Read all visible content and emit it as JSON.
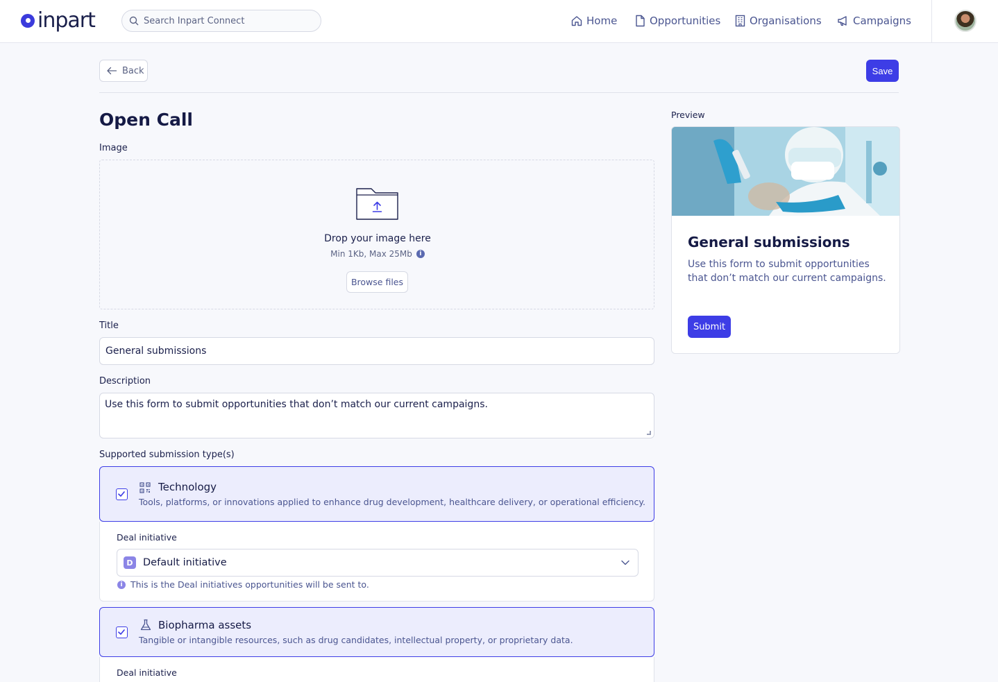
{
  "header": {
    "logo_text": "inpart",
    "search": {
      "placeholder": "Search Inpart Connect"
    },
    "nav": [
      {
        "label": "Home",
        "icon": "home-icon"
      },
      {
        "label": "Opportunities",
        "icon": "file-icon"
      },
      {
        "label": "Organisations",
        "icon": "building-icon"
      },
      {
        "label": "Campaigns",
        "icon": "megaphone-icon"
      }
    ]
  },
  "toolbar": {
    "back_label": "Back",
    "save_label": "Save"
  },
  "form": {
    "page_title": "Open Call",
    "image_label": "Image",
    "dropzone": {
      "title": "Drop your image here",
      "hint": "Min 1Kb, Max 25Mb",
      "browse_label": "Browse files"
    },
    "title_label": "Title",
    "title_value": "General submissions",
    "description_label": "Description",
    "description_value": "Use this form to submit opportunities that don’t match our current campaigns.",
    "types_label": "Supported submission type(s)",
    "types": [
      {
        "name": "Technology",
        "icon": "qr-grid-icon",
        "checked": true,
        "description": "Tools, platforms, or innovations applied to enhance drug development, healthcare delivery, or operational efficiency.",
        "deal_label": "Deal initiative",
        "deal_badge": "D",
        "deal_value": "Default initiative",
        "deal_hint": "This is the Deal initiatives opportunities will be sent to."
      },
      {
        "name": "Biopharma assets",
        "icon": "flask-icon",
        "checked": true,
        "description": "Tangible or intangible resources, such as drug candidates, intellectual property, or proprietary data.",
        "deal_label": "Deal initiative"
      }
    ]
  },
  "preview": {
    "label": "Preview",
    "title": "General submissions",
    "description": "Use this form to submit opportunities that don’t match our current campaigns.",
    "submit_label": "Submit"
  },
  "colors": {
    "accent": "#3d3de6",
    "text_dark": "#151a45",
    "text_muted": "#4a5590",
    "selected_bg": "#ecedfd"
  }
}
